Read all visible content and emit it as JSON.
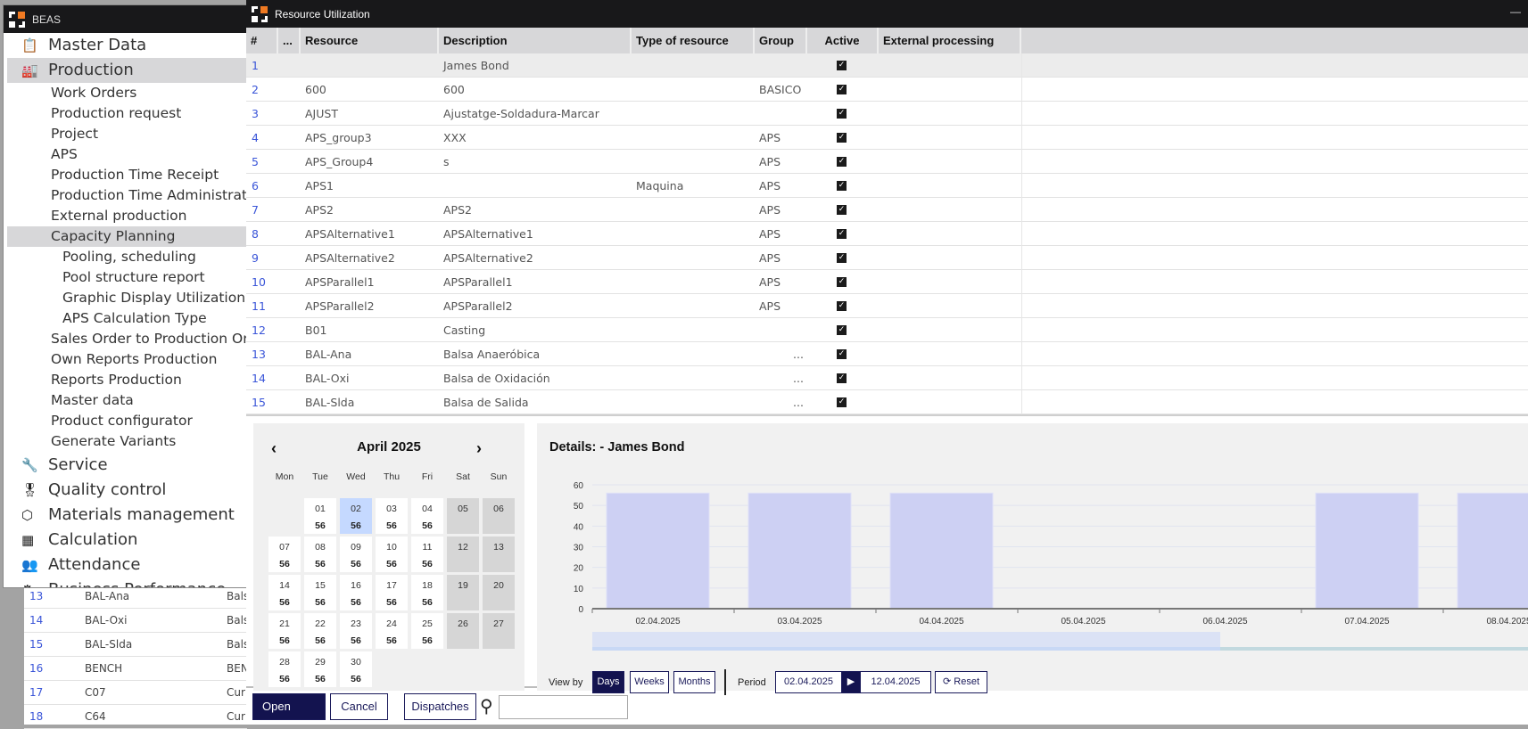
{
  "beas": {
    "title": "BEAS",
    "items": [
      {
        "label": "Master Data",
        "level": "top",
        "icon": "clipboard-icon",
        "glyph": "📋"
      },
      {
        "label": "Production",
        "level": "top",
        "icon": "factory-icon",
        "glyph": "🏭",
        "selected": true
      },
      {
        "label": "Work Orders",
        "level": "sub"
      },
      {
        "label": "Production request",
        "level": "sub"
      },
      {
        "label": "Project",
        "level": "sub"
      },
      {
        "label": "APS",
        "level": "sub"
      },
      {
        "label": "Production Time Receipt",
        "level": "sub"
      },
      {
        "label": "Production Time Administration",
        "level": "sub"
      },
      {
        "label": "External production",
        "level": "sub"
      },
      {
        "label": "Capacity Planning",
        "level": "sub",
        "selected": true
      },
      {
        "label": "Pooling,  scheduling",
        "level": "sub2"
      },
      {
        "label": "Pool structure report",
        "level": "sub2"
      },
      {
        "label": "Graphic Display Utilization",
        "level": "sub2"
      },
      {
        "label": "APS Calculation Type",
        "level": "sub2"
      },
      {
        "label": "Sales Order to Production Order",
        "level": "sub"
      },
      {
        "label": "Own Reports Production",
        "level": "sub"
      },
      {
        "label": "Reports Production",
        "level": "sub"
      },
      {
        "label": "Master data",
        "level": "sub"
      },
      {
        "label": "Product configurator",
        "level": "sub"
      },
      {
        "label": "Generate Variants",
        "level": "sub"
      },
      {
        "label": "Service",
        "level": "top",
        "icon": "wrench-icon",
        "glyph": "🔧"
      },
      {
        "label": "Quality control",
        "level": "top",
        "icon": "award-icon",
        "glyph": "🎖"
      },
      {
        "label": "Materials management",
        "level": "top",
        "icon": "box-icon",
        "glyph": "⬡"
      },
      {
        "label": "Calculation",
        "level": "top",
        "icon": "calculator-icon",
        "glyph": "▦"
      },
      {
        "label": "Attendance",
        "level": "top",
        "icon": "people-icon",
        "glyph": "👥"
      },
      {
        "label": "Business Performance",
        "level": "top",
        "icon": "gear-icon",
        "glyph": "⚙"
      }
    ]
  },
  "background_table": {
    "rows": [
      {
        "n": "13",
        "resource": "BAL-Ana",
        "desc": "Bals"
      },
      {
        "n": "14",
        "resource": "BAL-Oxi",
        "desc": "Bals"
      },
      {
        "n": "15",
        "resource": "BAL-Slda",
        "desc": "Bals"
      },
      {
        "n": "16",
        "resource": "BENCH",
        "desc": "BEN"
      },
      {
        "n": "17",
        "resource": "C07",
        "desc": "Cur"
      },
      {
        "n": "18",
        "resource": "C64",
        "desc": "Cur"
      }
    ]
  },
  "window": {
    "title": "Resource Utilization",
    "minimize": "—"
  },
  "table": {
    "columns": [
      "#",
      "...",
      "Resource",
      "Description",
      "Type of resource",
      "Group",
      "Active",
      "External processing"
    ],
    "rows": [
      {
        "n": "1",
        "resource": "",
        "desc": "James  Bond",
        "type": "",
        "group": "",
        "ext": "",
        "active": true
      },
      {
        "n": "2",
        "resource": "600",
        "desc": "600",
        "type": "",
        "group": "BASICO",
        "ext": "",
        "active": true
      },
      {
        "n": "3",
        "resource": "AJUST",
        "desc": "Ajustatge-Soldadura-Marcar",
        "type": "",
        "group": "",
        "ext": "",
        "active": true
      },
      {
        "n": "4",
        "resource": "APS_group3",
        "desc": "XXX",
        "type": "",
        "group": "APS",
        "ext": "",
        "active": true
      },
      {
        "n": "5",
        "resource": "APS_Group4",
        "desc": "s",
        "type": "",
        "group": "APS",
        "ext": "",
        "active": true
      },
      {
        "n": "6",
        "resource": "APS1",
        "desc": "",
        "type": "Maquina",
        "group": "APS",
        "ext": "",
        "active": true
      },
      {
        "n": "7",
        "resource": "APS2",
        "desc": "APS2",
        "type": "",
        "group": "APS",
        "ext": "",
        "active": true
      },
      {
        "n": "8",
        "resource": "APSAlternative1",
        "desc": "APSAlternative1",
        "type": "",
        "group": "APS",
        "ext": "",
        "active": true
      },
      {
        "n": "9",
        "resource": "APSAlternative2",
        "desc": "APSAlternative2",
        "type": "",
        "group": "APS",
        "ext": "",
        "active": true
      },
      {
        "n": "10",
        "resource": "APSParallel1",
        "desc": "APSParallel1",
        "type": "",
        "group": "APS",
        "ext": "",
        "active": true
      },
      {
        "n": "11",
        "resource": "APSParallel2",
        "desc": "APSParallel2",
        "type": "",
        "group": "APS",
        "ext": "",
        "active": true
      },
      {
        "n": "12",
        "resource": "B01",
        "desc": "Casting",
        "type": "",
        "group": "",
        "ext": "",
        "active": true
      },
      {
        "n": "13",
        "resource": "BAL-Ana",
        "desc": "Balsa Anaeróbica",
        "type": "",
        "group": "...",
        "ext": "",
        "active": true
      },
      {
        "n": "14",
        "resource": "BAL-Oxi",
        "desc": "Balsa de Oxidación",
        "type": "",
        "group": "...",
        "ext": "",
        "active": true
      },
      {
        "n": "15",
        "resource": "BAL-Slda",
        "desc": "Balsa de Salida",
        "type": "",
        "group": "...",
        "ext": "",
        "active": true
      }
    ]
  },
  "calendar": {
    "title": "April 2025",
    "prev": "‹",
    "next": "›",
    "weekdays": [
      "Mon",
      "Tue",
      "Wed",
      "Thu",
      "Fri",
      "Sat",
      "Sun"
    ],
    "days": [
      {
        "d": "01",
        "v": "56"
      },
      {
        "d": "02",
        "v": "56",
        "selected": true
      },
      {
        "d": "03",
        "v": "56"
      },
      {
        "d": "04",
        "v": "56"
      },
      {
        "d": "05",
        "v": "",
        "weekend": true
      },
      {
        "d": "06",
        "v": "",
        "weekend": true
      },
      {
        "d": "07",
        "v": "56"
      },
      {
        "d": "08",
        "v": "56"
      },
      {
        "d": "09",
        "v": "56"
      },
      {
        "d": "10",
        "v": "56"
      },
      {
        "d": "11",
        "v": "56"
      },
      {
        "d": "12",
        "v": "",
        "weekend": true
      },
      {
        "d": "13",
        "v": "",
        "weekend": true
      },
      {
        "d": "14",
        "v": "56"
      },
      {
        "d": "15",
        "v": "56"
      },
      {
        "d": "16",
        "v": "56"
      },
      {
        "d": "17",
        "v": "56"
      },
      {
        "d": "18",
        "v": "56"
      },
      {
        "d": "19",
        "v": "",
        "weekend": true
      },
      {
        "d": "20",
        "v": "",
        "weekend": true
      },
      {
        "d": "21",
        "v": "56"
      },
      {
        "d": "22",
        "v": "56"
      },
      {
        "d": "23",
        "v": "56"
      },
      {
        "d": "24",
        "v": "56"
      },
      {
        "d": "25",
        "v": "56"
      },
      {
        "d": "26",
        "v": "",
        "weekend": true
      },
      {
        "d": "27",
        "v": "",
        "weekend": true
      },
      {
        "d": "28",
        "v": "56"
      },
      {
        "d": "29",
        "v": "56"
      },
      {
        "d": "30",
        "v": "56"
      }
    ]
  },
  "details": {
    "title": "Details:  - James  Bond"
  },
  "chart_data": {
    "type": "bar",
    "categories": [
      "02.04.2025",
      "03.04.2025",
      "04.04.2025",
      "05.04.2025",
      "06.04.2025",
      "07.04.2025",
      "08.04.2025"
    ],
    "values": [
      56,
      56,
      56,
      0,
      0,
      56,
      56
    ],
    "ylim": [
      0,
      60
    ],
    "yticks": [
      0,
      10,
      20,
      30,
      40,
      50,
      60
    ],
    "grid": true,
    "bar_color": "#cdd0f3"
  },
  "controls": {
    "view_by": "View by",
    "days": "Days",
    "weeks": "Weeks",
    "months": "Months",
    "period": "Period",
    "from": "02.04.2025",
    "to": "12.04.2025",
    "reset": "Reset",
    "active_view": "Days"
  },
  "footer": {
    "open": "Open",
    "cancel": "Cancel",
    "dispatches": "Dispatches",
    "search_value": ""
  },
  "colors": {
    "accent": "#13134f",
    "title_bar": "#18181a",
    "link_number": "#3a55d8",
    "logo_orange": "#f07a22"
  }
}
